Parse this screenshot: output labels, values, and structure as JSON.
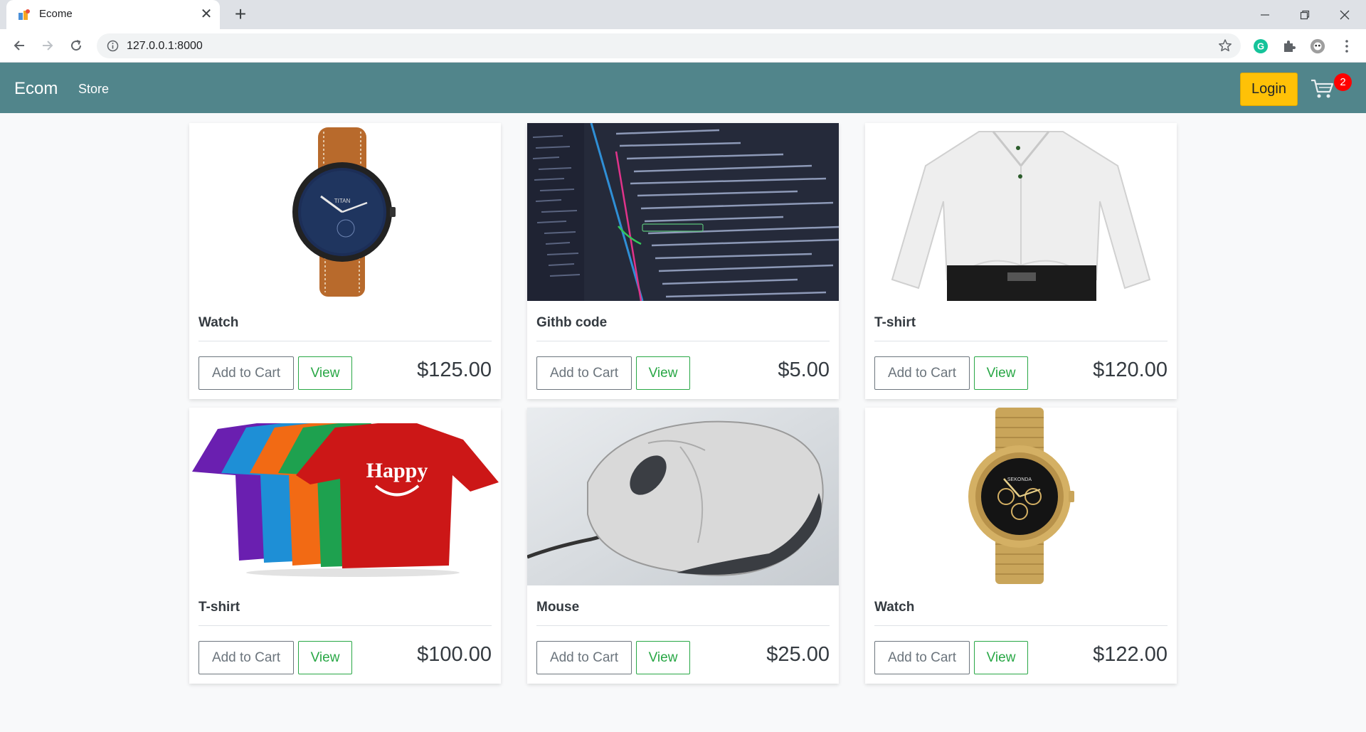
{
  "browser": {
    "tab_title": "Ecome",
    "url": "127.0.0.1:8000"
  },
  "site": {
    "brand": "Ecom",
    "nav_store": "Store",
    "login_label": "Login",
    "cart_count": "2",
    "colors": {
      "navbar": "#51858b",
      "login": "#ffc107",
      "view": "#28a745",
      "badge": "#ff0000"
    }
  },
  "products": [
    {
      "name": "Watch",
      "price": "$125.00",
      "image": "brown-leather-watch",
      "add_label": "Add to Cart",
      "view_label": "View"
    },
    {
      "name": "Githb code",
      "price": "$5.00",
      "image": "code-screenshot",
      "add_label": "Add to Cart",
      "view_label": "View"
    },
    {
      "name": "T-shirt",
      "price": "$120.00",
      "image": "white-dress-shirt",
      "add_label": "Add to Cart",
      "view_label": "View"
    },
    {
      "name": "T-shirt",
      "price": "$100.00",
      "image": "colored-tshirts",
      "add_label": "Add to Cart",
      "view_label": "View"
    },
    {
      "name": "Mouse",
      "price": "$25.00",
      "image": "computer-mouse",
      "add_label": "Add to Cart",
      "view_label": "View"
    },
    {
      "name": "Watch",
      "price": "$122.00",
      "image": "gold-chronograph-watch",
      "add_label": "Add to Cart",
      "view_label": "View"
    }
  ]
}
